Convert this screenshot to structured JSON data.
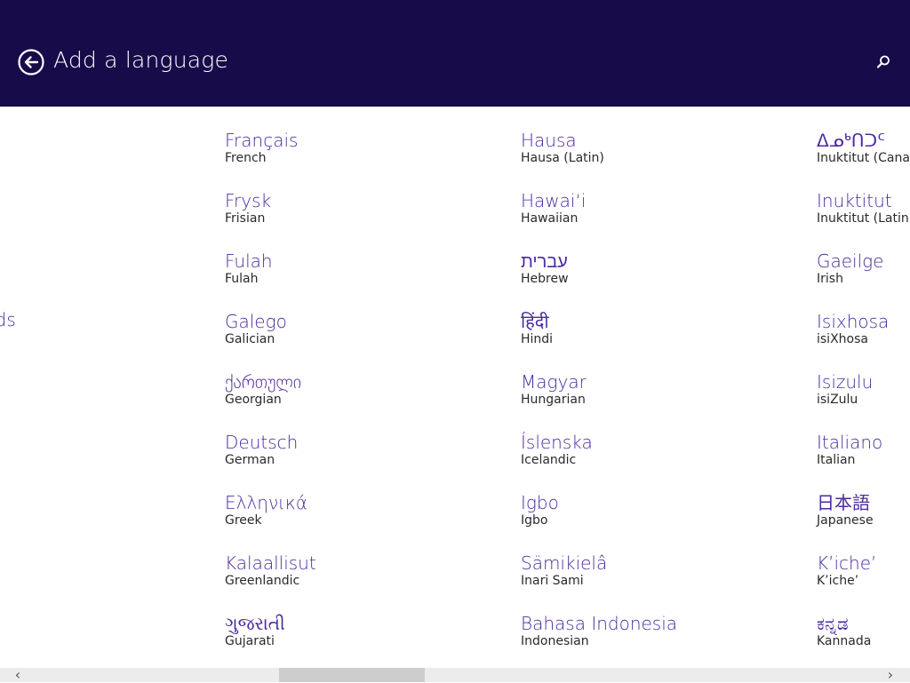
{
  "header": {
    "title": "Add a language",
    "back_icon": "back-arrow-circle-icon",
    "search_icon": "search-icon",
    "background_color": "#180b4a"
  },
  "partial_item": {
    "native": "nds"
  },
  "columns": [
    {
      "items": [
        {
          "native": "Français",
          "english": "French"
        },
        {
          "native": "Frysk",
          "english": "Frisian"
        },
        {
          "native": "Fulah",
          "english": "Fulah"
        },
        {
          "native": "Galego",
          "english": "Galician"
        },
        {
          "native": "ქართული",
          "english": "Georgian"
        },
        {
          "native": "Deutsch",
          "english": "German"
        },
        {
          "native": "Ελληνικά",
          "english": "Greek"
        },
        {
          "native": "Kalaallisut",
          "english": "Greenlandic"
        },
        {
          "native": "ગુજરાતી",
          "english": "Gujarati"
        }
      ]
    },
    {
      "items": [
        {
          "native": "Hausa",
          "english": "Hausa (Latin)"
        },
        {
          "native": "Hawaiʻi",
          "english": "Hawaiian"
        },
        {
          "native": "עברית",
          "english": "Hebrew"
        },
        {
          "native": "हिंदी",
          "english": "Hindi"
        },
        {
          "native": "Magyar",
          "english": "Hungarian"
        },
        {
          "native": "Íslenska",
          "english": "Icelandic"
        },
        {
          "native": "Igbo",
          "english": "Igbo"
        },
        {
          "native": "Sämikielâ",
          "english": "Inari Sami"
        },
        {
          "native": "Bahasa Indonesia",
          "english": "Indonesian"
        }
      ]
    },
    {
      "items": [
        {
          "native": "ᐃᓄᒃᑎᑐᑦ",
          "english": "Inuktitut (Canadian"
        },
        {
          "native": "Inuktitut",
          "english": "Inuktitut (Latin)"
        },
        {
          "native": "Gaeilge",
          "english": "Irish"
        },
        {
          "native": "Isixhosa",
          "english": "isiXhosa"
        },
        {
          "native": "Isizulu",
          "english": "isiZulu"
        },
        {
          "native": "Italiano",
          "english": "Italian"
        },
        {
          "native": "日本語",
          "english": "Japanese"
        },
        {
          "native": "K’iche’",
          "english": "K’iche’"
        },
        {
          "native": "ಕನ್ನಡ",
          "english": "Kannada"
        }
      ]
    }
  ],
  "scrollbar": {
    "left_icon": "chevron-left-icon",
    "right_icon": "chevron-right-icon"
  }
}
